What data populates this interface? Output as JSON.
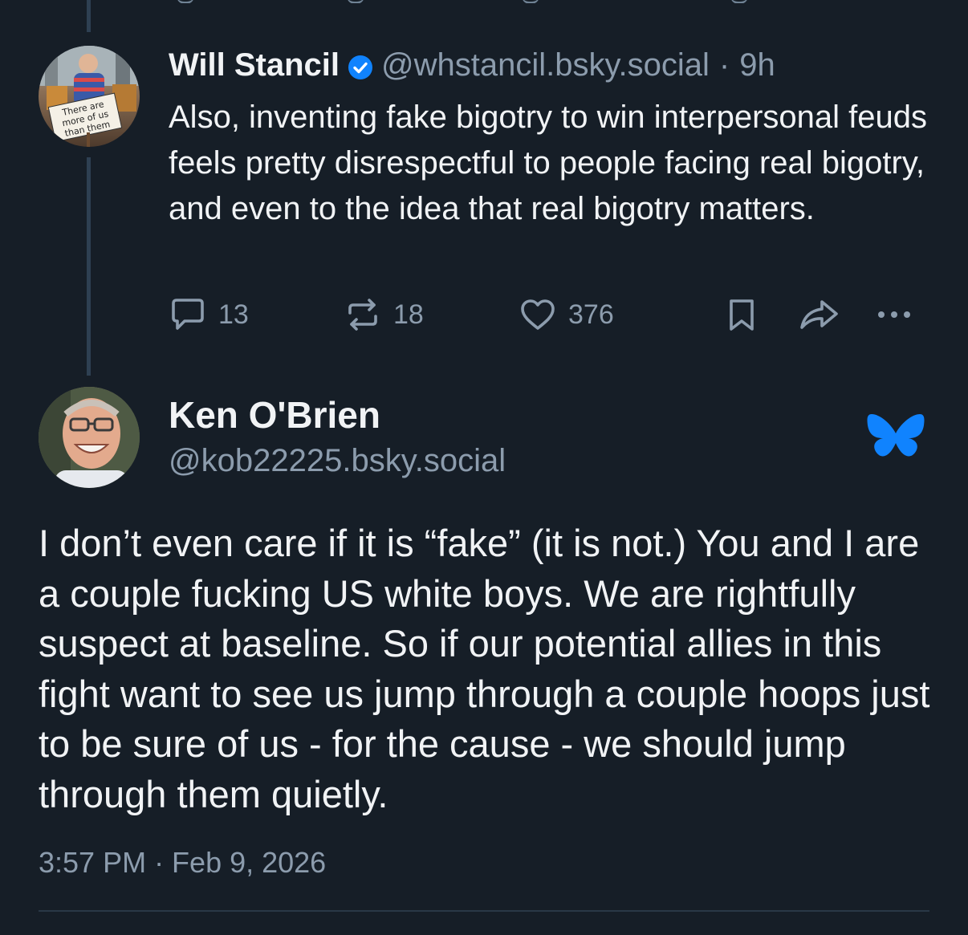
{
  "parent_post": {
    "display_name": "Will Stancil",
    "verified": true,
    "handle": "@whstancil.bsky.social",
    "separator": "·",
    "age": "9h",
    "text": "Also, inventing fake bigotry to win interpersonal feuds feels pretty disrespectful to people facing real bigotry, and even to the idea that real bigotry matters.",
    "avatar_sign_text": "There are more of us than them",
    "counts": {
      "replies": "13",
      "reposts": "18",
      "likes": "376"
    }
  },
  "focused_post": {
    "display_name": "Ken O'Brien",
    "handle": "@kob22225.bsky.social",
    "text": " I don’t even care if it is “fake” (it is not.) You and I are a couple fucking US white boys. We are rightfully suspect at baseline. So if our potential allies in this fight want to see us jump through a couple hoops just to be sure of us - for the cause - we should jump through them quietly.",
    "timestamp": "3:57 PM · Feb 9, 2026"
  },
  "icons": {
    "verified": "verified-check-icon",
    "reply": "reply-bubble-icon",
    "repost": "repost-icon",
    "like": "heart-icon",
    "bookmark": "bookmark-icon",
    "share": "share-arrow-icon",
    "more": "more-dots-icon",
    "brand": "bluesky-butterfly-icon"
  },
  "colors": {
    "background": "#161e27",
    "text_primary": "#f1f3f5",
    "text_secondary": "#8c9cad",
    "accent": "#1083fe",
    "thread_line": "#2e4052"
  }
}
